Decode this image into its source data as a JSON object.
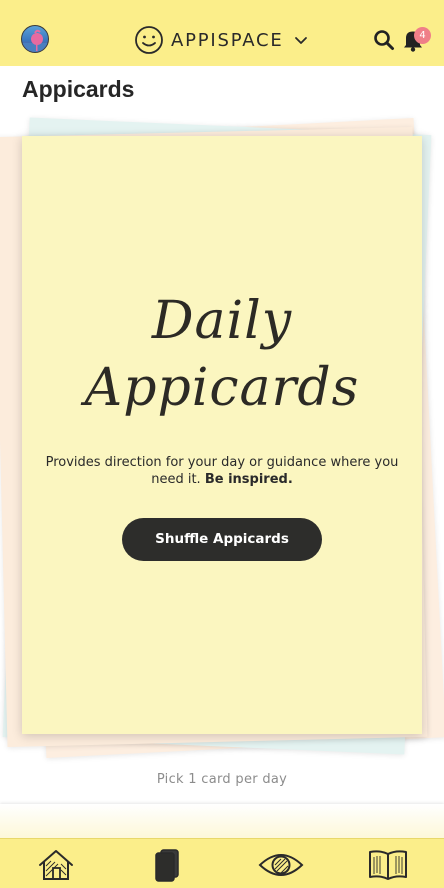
{
  "header": {
    "brand_name": "APPISPACE",
    "notification_count": "4",
    "icons": {
      "avatar": "profile-avatar",
      "logo": "smiley-logo-icon",
      "chevron": "chevron-down-icon",
      "search": "search-icon",
      "bell": "bell-icon"
    }
  },
  "page": {
    "title": "Appicards"
  },
  "card": {
    "heading_line1": "Daily",
    "heading_line2": "Appicards",
    "description_main": "Provides direction for your day or guidance where you need it.",
    "description_emphasis": "Be inspired.",
    "button_label": "Shuffle Appicards"
  },
  "footer_hint": "Pick 1 card per day",
  "bottom_nav": {
    "items": [
      {
        "icon": "home-icon"
      },
      {
        "icon": "cards-icon"
      },
      {
        "icon": "eye-icon"
      },
      {
        "icon": "book-icon"
      }
    ]
  },
  "colors": {
    "header_bg": "#fbee8a",
    "card_bg": "#fbf6c0",
    "button_bg": "#2d2d2b",
    "badge_bg": "#ef7f88"
  }
}
